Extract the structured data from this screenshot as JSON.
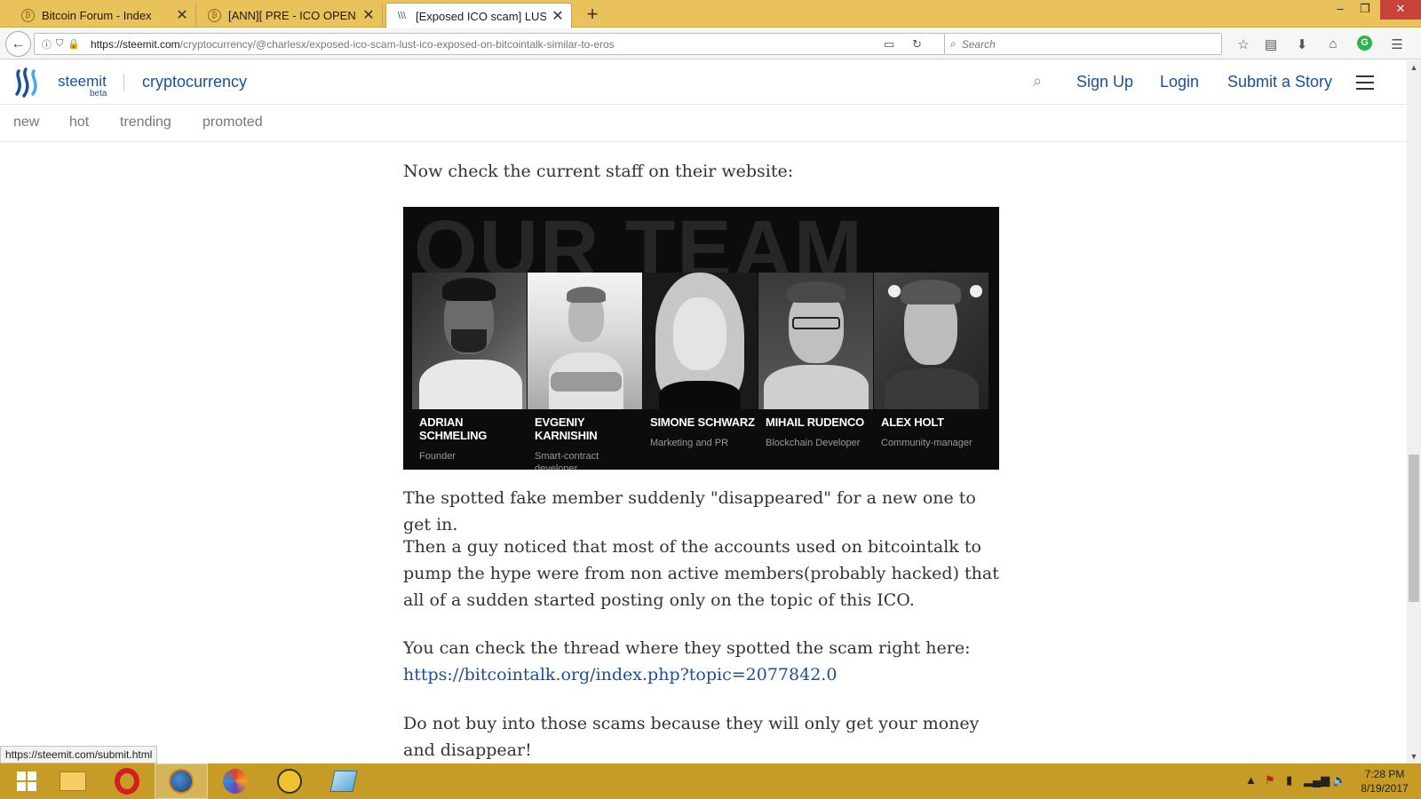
{
  "browser": {
    "tabs": [
      {
        "title": "Bitcoin Forum - Index"
      },
      {
        "title": "[ANN][   PRE - ICO OPEN"
      },
      {
        "title": "[Exposed ICO scam] LUST IC"
      }
    ],
    "url_host": "https://steemit.com",
    "url_path": "/cryptocurrency/@charlesx/exposed-ico-scam-lust-ico-exposed-on-bitcointalk-similar-to-eros",
    "search_placeholder": "Search"
  },
  "site": {
    "brand": "steemit",
    "beta": "beta",
    "category": "cryptocurrency",
    "links": {
      "signup": "Sign Up",
      "login": "Login",
      "submit": "Submit a Story"
    },
    "sort_tabs": [
      "new",
      "hot",
      "trending",
      "promoted"
    ]
  },
  "post": {
    "p1": "Now check the current staff on their website:",
    "team_title": "OUR TEAM",
    "team": [
      {
        "name": "ADRIAN SCHMELING",
        "role": "Founder"
      },
      {
        "name": "EVGENIY KARNISHIN",
        "role": "Smart-contract developer"
      },
      {
        "name": "SIMONE SCHWARZ",
        "role": "Marketing and PR"
      },
      {
        "name": "MIHAIL RUDENCO",
        "role": "Blockchain Developer"
      },
      {
        "name": "ALEX HOLT",
        "role": "Community-manager"
      }
    ],
    "p2": "The spotted fake member suddenly \"disappeared\" for a new one to get in.",
    "p3": "Then a guy noticed that most of the accounts used on bitcointalk to pump the hype were from non active members(probably hacked) that all of a sudden started posting only on the topic of this ICO.",
    "p4": "You can check the thread where they spotted the scam right here:",
    "p4_link": "https://bitcointalk.org/index.php?topic=2077842.0",
    "p5": "Do not buy into those scams because they will only get your money and disappear!"
  },
  "status_link": "https://steemit.com/submit.html",
  "clock": {
    "time": "7:28 PM",
    "date": "8/19/2017"
  }
}
